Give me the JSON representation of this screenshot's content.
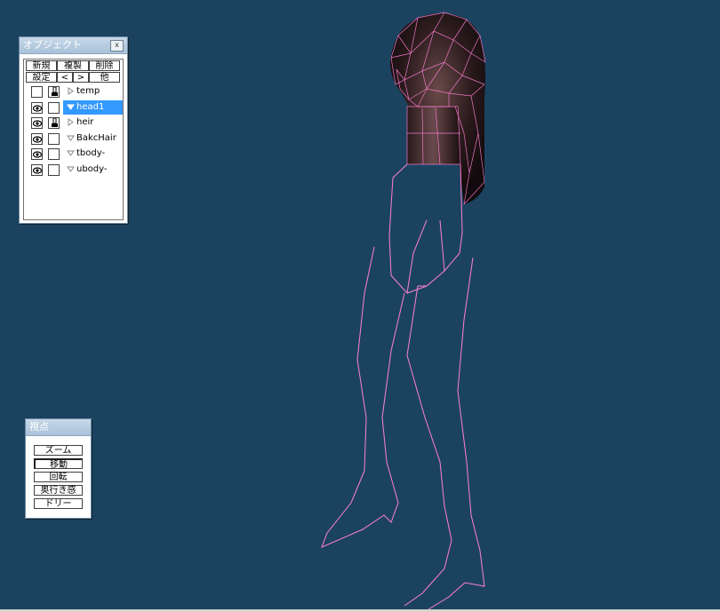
{
  "object_window": {
    "title": "オブジェクト",
    "close_label": "x",
    "buttons_row1": [
      "新規",
      "複製",
      "削除"
    ],
    "buttons_row2": [
      "設定",
      "<",
      ">",
      "他"
    ],
    "objects": [
      {
        "name": "temp",
        "visible": false,
        "locked": true,
        "expanded": false,
        "selected": false
      },
      {
        "name": "head1",
        "visible": true,
        "locked": false,
        "expanded": true,
        "selected": true
      },
      {
        "name": "heir",
        "visible": true,
        "locked": true,
        "expanded": false,
        "selected": false
      },
      {
        "name": "BakcHair",
        "visible": true,
        "locked": false,
        "expanded": true,
        "selected": false
      },
      {
        "name": "tbody-",
        "visible": true,
        "locked": false,
        "expanded": true,
        "selected": false
      },
      {
        "name": "ubody-",
        "visible": true,
        "locked": false,
        "expanded": true,
        "selected": false
      }
    ]
  },
  "view_panel": {
    "title": "視点",
    "buttons": [
      "ズーム",
      "移動",
      "回転",
      "奥行き感",
      "ドリー"
    ],
    "active_button": "移動"
  },
  "colors": {
    "viewport_bg": "#1b4360",
    "wireframe": "#ff7fd4",
    "selection": "#3399ff"
  }
}
